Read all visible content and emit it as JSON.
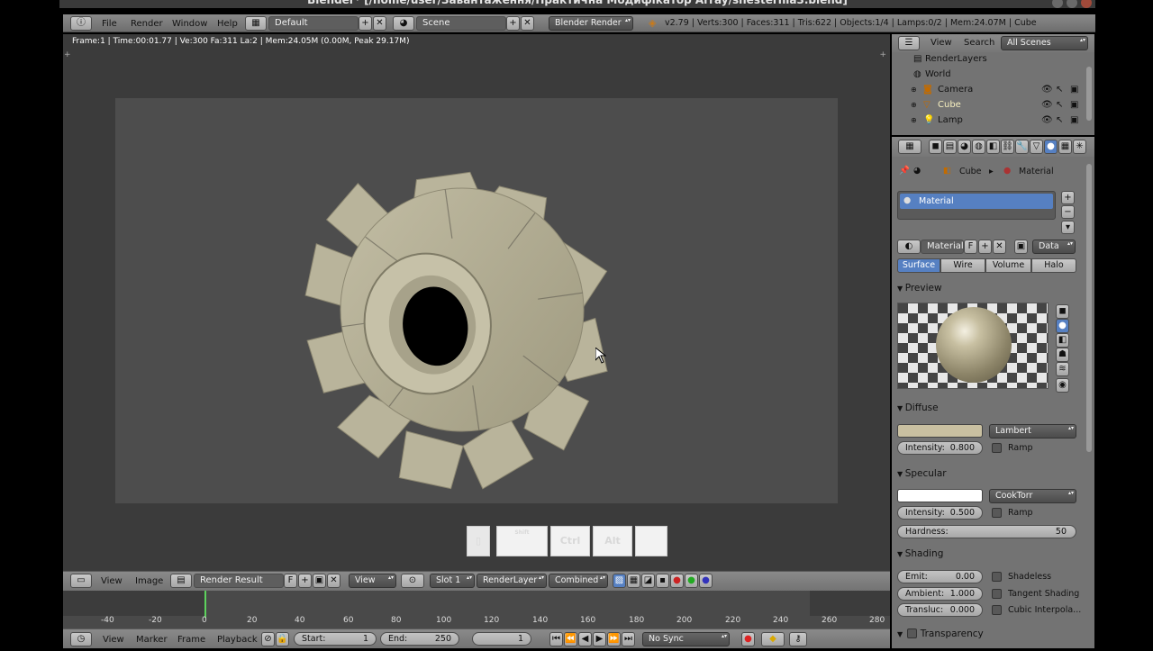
{
  "window": {
    "title": "Blender* [/home/user/Завантаження/Практична Модифікатор Array/shesternia3.blend]"
  },
  "topbar": {
    "menus": [
      "File",
      "Render",
      "Window",
      "Help"
    ],
    "layout": "Default",
    "scene": "Scene",
    "engine": "Blender Render",
    "stats": "v2.79 | Verts:300 | Faces:311 | Tris:622 | Objects:1/4 | Lamps:0/2 | Mem:24.07M | Cube"
  },
  "viewport": {
    "info": "Frame:1 | Time:00:01.77 | Ve:300 Fa:311 La:2 | Mem:24.05M (0.00M, Peak 29.17M)",
    "keys": [
      "Shift",
      "Ctrl",
      "Alt",
      ""
    ]
  },
  "image_header": {
    "menus": [
      "View",
      "Image"
    ],
    "image_name": "Render Result",
    "fake_user": "F",
    "view": "View",
    "slot": "Slot 1",
    "layer": "RenderLayer",
    "pass": "Combined"
  },
  "timeline": {
    "ticks": [
      "-40",
      "-20",
      "0",
      "20",
      "40",
      "60",
      "80",
      "100",
      "120",
      "140",
      "160",
      "180",
      "200",
      "220",
      "240",
      "260",
      "280"
    ],
    "current_frame_tick": "0",
    "menus": [
      "View",
      "Marker",
      "Frame",
      "Playback"
    ],
    "start_label": "Start:",
    "start": "1",
    "end_label": "End:",
    "end": "250",
    "current": "1",
    "sync": "No Sync"
  },
  "outliner": {
    "menus": [
      "View",
      "Search"
    ],
    "filter": "All Scenes",
    "items": [
      {
        "label": "RenderLayers",
        "icon": "renderlayers-icon"
      },
      {
        "label": "World",
        "icon": "world-icon"
      },
      {
        "label": "Camera",
        "icon": "camera-icon"
      },
      {
        "label": "Cube",
        "icon": "mesh-icon",
        "active": true
      },
      {
        "label": "Lamp",
        "icon": "lamp-icon"
      }
    ]
  },
  "properties": {
    "breadcrumb": [
      "Cube",
      "Material"
    ],
    "slot": "Material",
    "material_name": "Material",
    "fake_user": "F",
    "link": "Data",
    "tabs": [
      "Surface",
      "Wire",
      "Volume",
      "Halo"
    ],
    "active_tab": "Surface",
    "preview": {
      "title": "Preview"
    },
    "diffuse": {
      "title": "Diffuse",
      "color": "#c9c0a1",
      "shader": "Lambert",
      "intensity_label": "Intensity:",
      "intensity": "0.800",
      "ramp": "Ramp"
    },
    "specular": {
      "title": "Specular",
      "color": "#ffffff",
      "shader": "CookTorr",
      "intensity_label": "Intensity:",
      "intensity": "0.500",
      "ramp": "Ramp",
      "hardness_label": "Hardness:",
      "hardness": "50"
    },
    "shading": {
      "title": "Shading",
      "emit_label": "Emit:",
      "emit": "0.00",
      "ambient_label": "Ambient:",
      "ambient": "1.000",
      "translucency_label": "Transluc:",
      "translucency": "0.000",
      "shadeless": "Shadeless",
      "tangent_shading": "Tangent Shading",
      "cubic": "Cubic Interpola..."
    },
    "transparency": {
      "title": "Transparency"
    }
  },
  "colors": {
    "accent": "#5680c2",
    "gear": "#b8b39a",
    "viewport": "#3b3b3b"
  }
}
